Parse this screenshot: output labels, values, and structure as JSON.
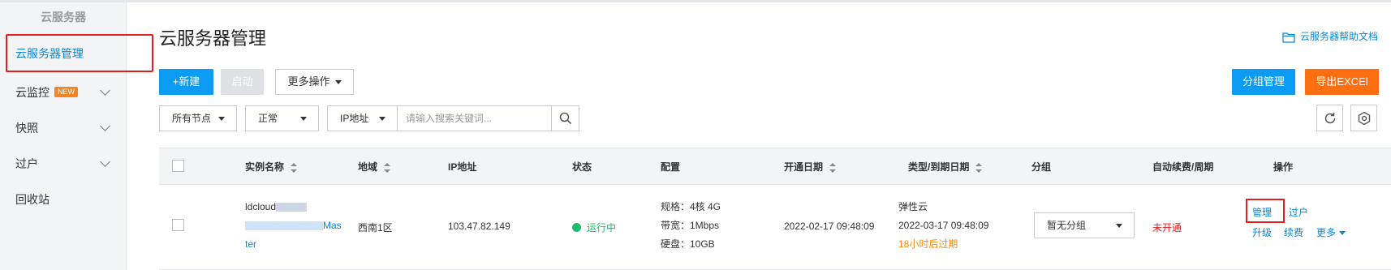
{
  "sidebar": {
    "title": "云服务器",
    "items": [
      {
        "label": "云服务器管理"
      },
      {
        "label": "云监控",
        "badge": "NEW"
      },
      {
        "label": "快照"
      },
      {
        "label": "过户"
      },
      {
        "label": "回收站"
      }
    ]
  },
  "header": {
    "title": "云服务器管理",
    "help_link": "云服务器帮助文档"
  },
  "toolbar": {
    "new_label": "+新建",
    "start_label": "启动",
    "more_ops_label": "更多操作",
    "group_manage_label": "分组管理",
    "export_label": "导出EXCEl"
  },
  "filters": {
    "node": "所有节点",
    "status": "正常",
    "field": "IP地址",
    "search_placeholder": "请输入搜索关键词..."
  },
  "table": {
    "headers": {
      "name": "实例名称",
      "region": "地域",
      "ip": "IP地址",
      "status": "状态",
      "config": "配置",
      "open_date": "开通日期",
      "type_expire": "类型/到期日期",
      "group": "分组",
      "auto_renew": "自动续费/周期",
      "actions": "操作"
    },
    "rows": [
      {
        "name_prefix": "ldcloud",
        "name_suffix_1": "Mas",
        "name_suffix_2": "ter",
        "region": "西南1区",
        "ip": "103.47.82.149",
        "status": "运行中",
        "spec": "规格：4核 4G",
        "bandwidth": "带宽：1Mbps",
        "disk": "硬盘：10GB",
        "open_date": "2022-02-17 09:48:09",
        "type": "弹性云",
        "expire_date": "2022-03-17 09:48:09",
        "expire_note": "18小时后过期",
        "group": "暂无分组",
        "auto_renew": "未开通",
        "actions": {
          "manage": "管理",
          "transfer": "过户",
          "upgrade": "升级",
          "renew": "续费",
          "more": "更多"
        }
      }
    ]
  },
  "colors": {
    "primary": "#0c9bf2",
    "link": "#0c87d8",
    "export": "#ff6f12",
    "running": "#19be6b",
    "danger": "#e02020",
    "warning": "#ff8a00"
  }
}
